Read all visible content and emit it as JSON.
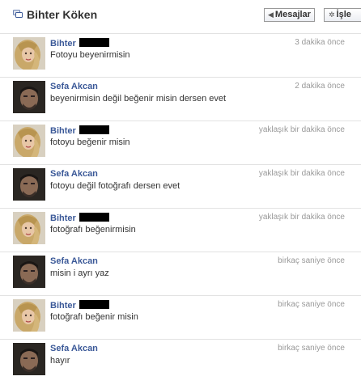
{
  "header": {
    "title": "Bihter Köken",
    "messages_button": "Mesajlar",
    "actions_button": "İşle"
  },
  "messages": [
    {
      "sender": "Bihter",
      "avatar": "female",
      "redacted": true,
      "time": "3 dakika önce",
      "text": "Fotoyu beyenirmisin"
    },
    {
      "sender": "Sefa Akcan",
      "avatar": "male",
      "redacted": false,
      "time": "2 dakika önce",
      "text": "beyenirmisin değil beğenir misin dersen evet"
    },
    {
      "sender": "Bihter",
      "avatar": "female",
      "redacted": true,
      "time": "yaklaşık bir dakika önce",
      "text": "fotoyu beğenir misin"
    },
    {
      "sender": "Sefa Akcan",
      "avatar": "male",
      "redacted": false,
      "time": "yaklaşık bir dakika önce",
      "text": "fotoyu değil fotoğrafı dersen evet"
    },
    {
      "sender": "Bihter",
      "avatar": "female",
      "redacted": true,
      "time": "yaklaşık bir dakika önce",
      "text": "fotoğrafı beğenirmisin"
    },
    {
      "sender": "Sefa Akcan",
      "avatar": "male",
      "redacted": false,
      "time": "birkaç saniye önce",
      "text": "misin i ayrı yaz"
    },
    {
      "sender": "Bihter",
      "avatar": "female",
      "redacted": true,
      "time": "birkaç saniye önce",
      "text": "fotoğrafı beğenir misin"
    },
    {
      "sender": "Sefa Akcan",
      "avatar": "male",
      "redacted": false,
      "time": "birkaç saniye önce",
      "text": "hayır"
    }
  ]
}
